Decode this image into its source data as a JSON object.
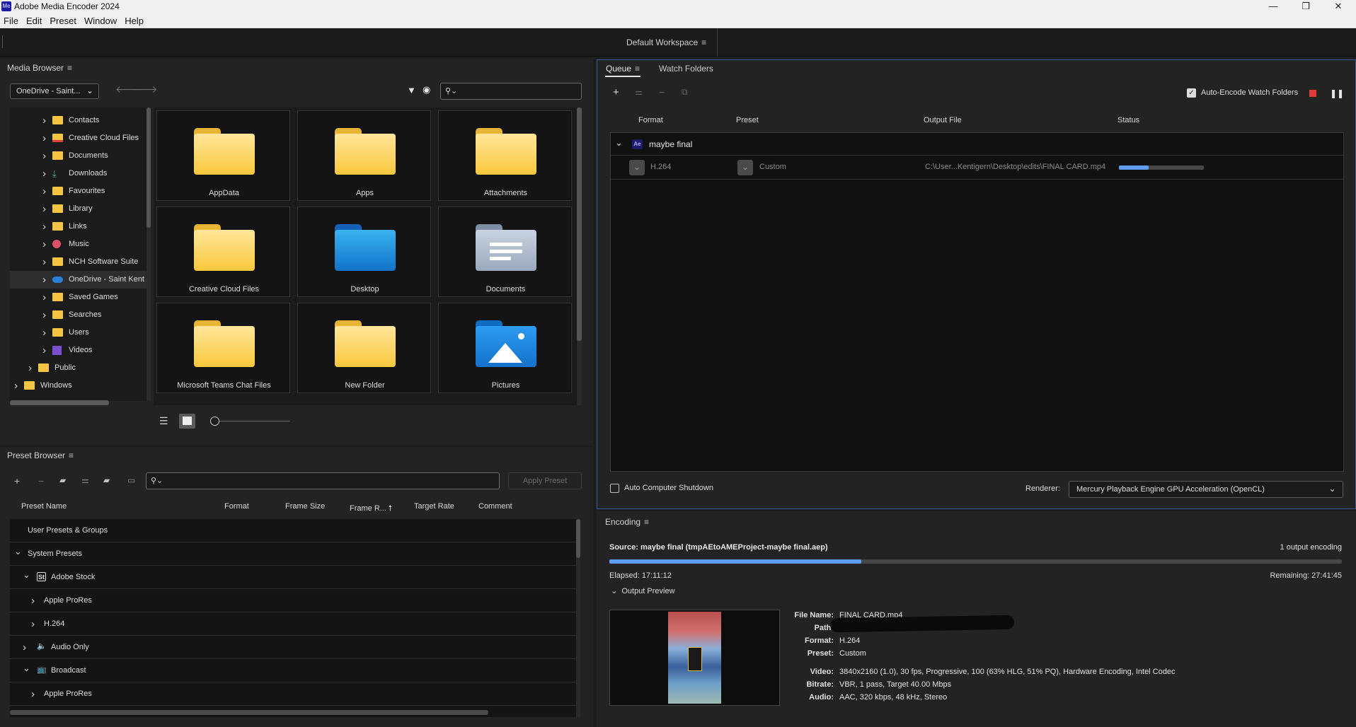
{
  "window": {
    "app_icon": "Me",
    "title": "Adobe Media Encoder 2024",
    "controls": {
      "minimize": "—",
      "maximize": "❐",
      "close": "✕"
    }
  },
  "menu": [
    "File",
    "Edit",
    "Preset",
    "Window",
    "Help"
  ],
  "workspace": {
    "label": "Default Workspace"
  },
  "media_browser": {
    "title": "Media Browser",
    "location": "OneDrive - Saint...",
    "tree": [
      {
        "label": "Contacts",
        "icon": "contacts-folder-icon"
      },
      {
        "label": "Creative Cloud Files",
        "icon": "creative-cloud-folder-icon"
      },
      {
        "label": "Documents",
        "icon": "folder-icon"
      },
      {
        "label": "Downloads",
        "icon": "download-arrow-icon"
      },
      {
        "label": "Favourites",
        "icon": "folder-icon"
      },
      {
        "label": "Library",
        "icon": "folder-icon"
      },
      {
        "label": "Links",
        "icon": "folder-icon"
      },
      {
        "label": "Music",
        "icon": "music-icon"
      },
      {
        "label": "NCH Software Suite",
        "icon": "folder-icon"
      },
      {
        "label": "OneDrive - Saint Kent",
        "icon": "onedrive-cloud-icon"
      },
      {
        "label": "Saved Games",
        "icon": "folder-icon"
      },
      {
        "label": "Searches",
        "icon": "folder-icon"
      },
      {
        "label": "Users",
        "icon": "folder-icon"
      },
      {
        "label": "Videos",
        "icon": "videos-icon"
      },
      {
        "label": "Public",
        "icon": "folder-icon"
      },
      {
        "label": "Windows",
        "icon": "folder-icon"
      }
    ],
    "tiles": [
      {
        "label": "AppData",
        "kind": "folder"
      },
      {
        "label": "Apps",
        "kind": "folder"
      },
      {
        "label": "Attachments",
        "kind": "folder"
      },
      {
        "label": "Creative Cloud Files",
        "kind": "folder"
      },
      {
        "label": "Desktop",
        "kind": "desktop"
      },
      {
        "label": "Documents",
        "kind": "documents"
      },
      {
        "label": "Microsoft Teams Chat Files",
        "kind": "folder"
      },
      {
        "label": "New Folder",
        "kind": "folder"
      },
      {
        "label": "Pictures",
        "kind": "pictures"
      }
    ]
  },
  "preset_browser": {
    "title": "Preset Browser",
    "apply_label": "Apply Preset",
    "columns": [
      "Preset Name",
      "Format",
      "Frame Size",
      "Frame R...",
      "Target Rate",
      "Comment"
    ],
    "rows": [
      {
        "label": "User Presets & Groups",
        "indent": 0,
        "chev": "",
        "icon": ""
      },
      {
        "label": "System Presets",
        "indent": 0,
        "chev": "⌄",
        "icon": ""
      },
      {
        "label": "Adobe Stock",
        "indent": 1,
        "chev": "⌄",
        "icon": "St"
      },
      {
        "label": "Apple ProRes",
        "indent": 2,
        "chev": "›",
        "icon": ""
      },
      {
        "label": "H.264",
        "indent": 2,
        "chev": "›",
        "icon": ""
      },
      {
        "label": "Audio Only",
        "indent": 1,
        "chev": "›",
        "icon": "🔈"
      },
      {
        "label": "Broadcast",
        "indent": 1,
        "chev": "⌄",
        "icon": "📺"
      },
      {
        "label": "Apple ProRes",
        "indent": 2,
        "chev": "›",
        "icon": ""
      }
    ]
  },
  "queue": {
    "tabs": [
      "Queue",
      "Watch Folders"
    ],
    "auto_encode_label": "Auto-Encode Watch Folders",
    "auto_encode_checked": true,
    "columns": [
      "Format",
      "Preset",
      "Output File",
      "Status"
    ],
    "group": {
      "badge": "Ae",
      "label": "maybe final"
    },
    "item": {
      "format": "H.264",
      "preset": "Custom",
      "output": "C:\\User...Kentigern\\Desktop\\edits\\FINAL CARD.mp4",
      "progress": 0.35
    },
    "auto_shutdown_label": "Auto Computer Shutdown",
    "renderer_label": "Renderer:",
    "renderer_value": "Mercury Playback Engine GPU Acceleration (OpenCL)"
  },
  "encoding": {
    "title": "Encoding",
    "source": "Source: maybe final (tmpAEtoAMEProject-maybe final.aep)",
    "outputs": "1 output encoding",
    "progress": 0.344,
    "elapsed": "Elapsed: 17:11:12",
    "remaining": "Remaining: 27:41:45",
    "preview_label": "Output Preview",
    "details": [
      {
        "k": "File Name:",
        "v": "FINAL CARD.mp4"
      },
      {
        "k": "Path:",
        "v": ""
      },
      {
        "k": "Format:",
        "v": "H.264"
      },
      {
        "k": "Preset:",
        "v": "Custom"
      },
      {
        "k": "Video:",
        "v": "3840x2160 (1.0), 30 fps, Progressive, 100 (63% HLG, 51% PQ), Hardware Encoding, Intel Codec"
      },
      {
        "k": "Bitrate:",
        "v": "VBR, 1 pass, Target 40.00 Mbps"
      },
      {
        "k": "Audio:",
        "v": "AAC, 320 kbps, 48 kHz, Stereo"
      }
    ]
  },
  "colors": {
    "accent": "#5e9ef2",
    "stop_red": "#e03a3a",
    "queue_border": "#3d5a9a",
    "folder": "#f8c73d"
  }
}
